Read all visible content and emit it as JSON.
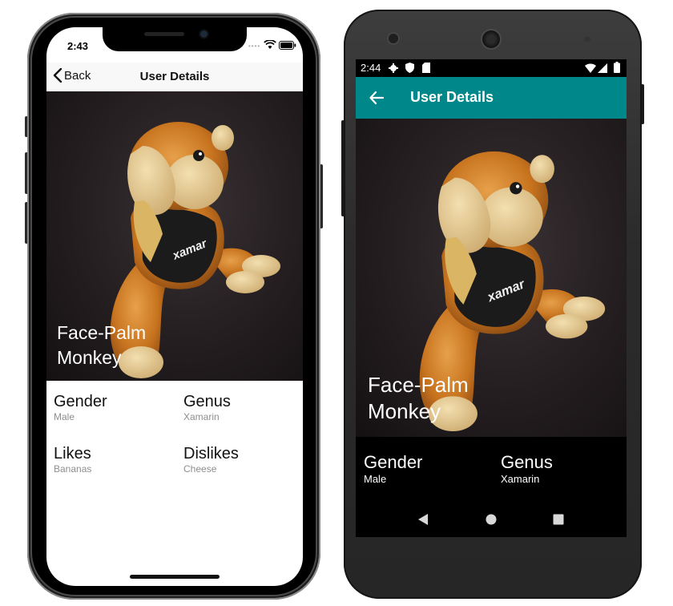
{
  "ios": {
    "status_time": "2:43",
    "back_label": "Back",
    "title": "User Details",
    "photo_caption_line1": "Face-Palm",
    "photo_caption_line2": "Monkey",
    "fields": [
      {
        "label": "Gender",
        "value": "Male"
      },
      {
        "label": "Genus",
        "value": "Xamarin"
      },
      {
        "label": "Likes",
        "value": "Bananas"
      },
      {
        "label": "Dislikes",
        "value": "Cheese"
      }
    ]
  },
  "android": {
    "status_time": "2:44",
    "title": "User Details",
    "photo_caption_line1": "Face-Palm",
    "photo_caption_line2": "Monkey",
    "fields": [
      {
        "label": "Gender",
        "value": "Male"
      },
      {
        "label": "Genus",
        "value": "Xamarin"
      }
    ],
    "appbar_color": "#00878a"
  },
  "toy_shirt_text": "xamar",
  "icons": [
    "back-chevron-icon",
    "wifi-icon",
    "battery-icon",
    "signal-icon",
    "settings-icon",
    "shield-icon",
    "sd-card-icon",
    "back-arrow-icon",
    "nav-back-icon",
    "nav-home-icon",
    "nav-recents-icon"
  ]
}
